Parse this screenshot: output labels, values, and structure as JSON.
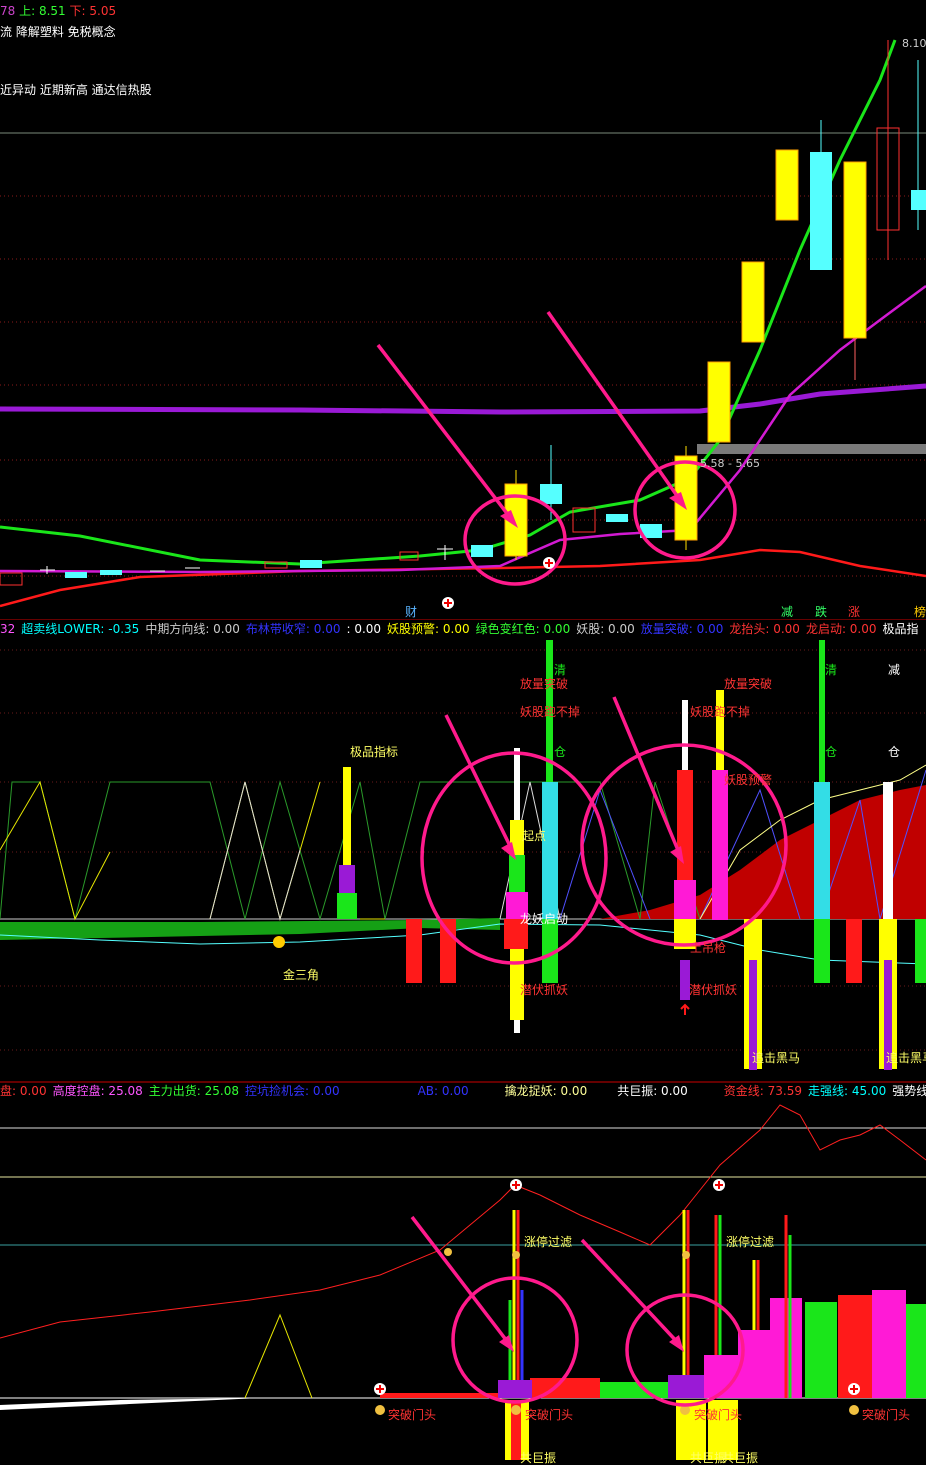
{
  "top_panel": {
    "price_info": {
      "prefix": "78",
      "upper_label": "上: 8.51",
      "lower_label": "下: 5.05"
    },
    "concepts_line1": "流 降解塑料 免税概念",
    "concepts_line2": "近异动 近期新高 通达信热股",
    "high_price_label": "8.10",
    "range_label": "5.58 - 5.65",
    "bottom_markers": [
      {
        "text": "财",
        "color": "#5ab4ff"
      },
      {
        "text": "减",
        "color": "#33ff66"
      },
      {
        "text": "跌",
        "color": "#33ff66"
      },
      {
        "text": "涨",
        "color": "#ff3333"
      },
      {
        "text": "榜",
        "color": "#ffcc00"
      }
    ]
  },
  "mid_panel": {
    "indicator_strip": [
      {
        "text": "32",
        "color": "#ff55ff"
      },
      {
        "text": "超卖线LOWER: -0.35",
        "color": "#00ffff"
      },
      {
        "text": "中期方向线: 0.00",
        "color": "#cccccc"
      },
      {
        "text": "布林带收窄: 0.00",
        "color": "#3333ff"
      },
      {
        "text": ": 0.00",
        "color": "#ffffff"
      },
      {
        "text": "妖股预警: 0.00",
        "color": "#ffff00"
      },
      {
        "text": "绿色变红色: 0.00",
        "color": "#33ff33"
      },
      {
        "text": "妖股: 0.00",
        "color": "#cccccc"
      },
      {
        "text": "放量突破: 0.00",
        "color": "#3333ff"
      },
      {
        "text": "龙抬头: 0.00",
        "color": "#ff3333"
      },
      {
        "text": "龙启动: 0.00",
        "color": "#ff3333"
      },
      {
        "text": "极品指",
        "color": "#ffffff"
      }
    ],
    "labels": {
      "jipin": "极品指标",
      "fangliang1": "放量突破",
      "yaogu1": "妖股跑不掉",
      "fangliang2": "放量突破",
      "yaogu2": "妖股跑不掉",
      "yaogu_yujing": "妖股预警",
      "qing1": "清",
      "cang1": "仓",
      "qing2": "清",
      "cang2": "仓",
      "jian": "减",
      "cang3": "仓",
      "qidian": "起点",
      "longyao": "龙妖启动",
      "jinsanjiao": "金三角",
      "qianfu1": "潜伏抓妖",
      "qianfu2": "潜伏抓妖",
      "tudi": "土吊枪",
      "zhuiji1": "追击黑马",
      "zhuiji2": "追击黑马"
    }
  },
  "bottom_panel": {
    "indicator_strip": [
      {
        "text": "盘: 0.00",
        "color": "#ff3333"
      },
      {
        "text": "高度控盘: 25.08",
        "color": "#ff55ff"
      },
      {
        "text": "主力出货: 25.08",
        "color": "#33ff33"
      },
      {
        "text": "控坑捡机会: 0.00",
        "color": "#3333ff"
      },
      {
        "text": "AB: 0.00",
        "color": "#3333ff"
      },
      {
        "text": "擒龙捉妖: 0.00",
        "color": "#ffff99"
      },
      {
        "text": "共巨振: 0.00",
        "color": "#ffffff"
      },
      {
        "text": "资金线: 73.59",
        "color": "#ff3333"
      },
      {
        "text": "走强线: 45.00",
        "color": "#00ffff"
      },
      {
        "text": "强势线:",
        "color": "#ffffff"
      }
    ],
    "labels": {
      "zhangting1": "涨停过滤",
      "zhangting2": "涨停过滤",
      "tupo1": "突破门头",
      "tupo2": "突破门头",
      "tupo3": "突破门头",
      "tupo4": "突破门头",
      "gongju1": "共巨振",
      "gongju2": "共巨振",
      "gongju3": "共巨振"
    }
  }
}
